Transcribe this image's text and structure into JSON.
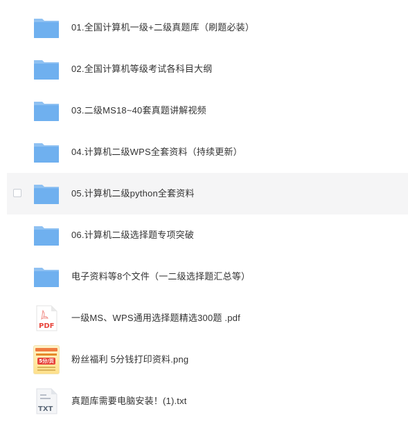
{
  "files": [
    {
      "name": "01.全国计算机一级+二级真题库（刷题必装）",
      "icon": "folder-icon"
    },
    {
      "name": "02.全国计算机等级考试各科目大纲",
      "icon": "folder-icon"
    },
    {
      "name": "03.二级MS18~40套真题讲解视频",
      "icon": "folder-icon"
    },
    {
      "name": "04.计算机二级WPS全套资料（持续更新）",
      "icon": "folder-icon"
    },
    {
      "name": "05.计算机二级python全套资料",
      "icon": "folder-icon"
    },
    {
      "name": "06.计算机二级选择题专项突破",
      "icon": "folder-icon"
    },
    {
      "name": "电子资料等8个文件（一二级选择题汇总等）",
      "icon": "folder-icon"
    },
    {
      "name": "一级MS、WPS通用选择题精选300题 .pdf",
      "icon": "pdf-file-icon",
      "icon_label": "PDF"
    },
    {
      "name": "粉丝福利 5分钱打印资料.png",
      "icon": "image-thumbnail",
      "thumb_badge": "5分/页"
    },
    {
      "name": "真题库需要电脑安装！(1).txt",
      "icon": "txt-file-icon",
      "icon_label": "TXT"
    }
  ],
  "colors": {
    "folder_back": "#8fc1f2",
    "folder_front": "#6fb0ef",
    "pdf_red": "#e8453c",
    "hover_row": "#f5f5f6"
  }
}
